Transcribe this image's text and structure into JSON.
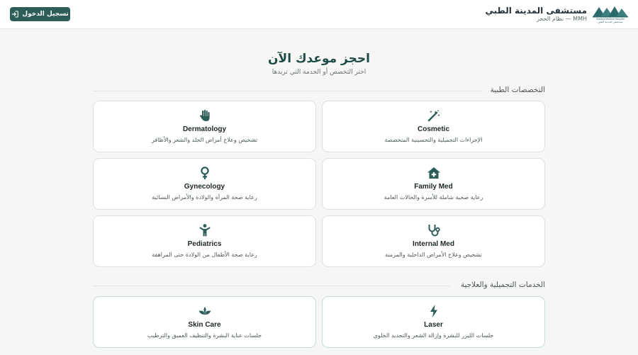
{
  "header": {
    "brand_title": "مستشفى المدينة الطبي",
    "brand_sub": "MMH — نظام الحجز",
    "logo_line1": "Madina Medical Hospital",
    "logo_line2": "مستشفى المدينة الطبي",
    "login_label": "تسجيل الدخول"
  },
  "hero": {
    "title": "احجز موعدك الآن",
    "subtitle": "اختر التخصص أو الخدمة التي تريدها"
  },
  "specialties": {
    "title": "التخصصات الطبية",
    "items": [
      {
        "name": "Cosmetic",
        "desc": "الإجراءات التجميلية والتحسينية المتخصصة",
        "icon": "magic-wand-icon"
      },
      {
        "name": "Dermatology",
        "desc": "تشخيص وعلاج أمراض الجلد والشعر والأظافر",
        "icon": "hand-icon"
      },
      {
        "name": "Family Med",
        "desc": "رعاية صحية شاملة للأسرة والحالات العامة",
        "icon": "house-medical-icon"
      },
      {
        "name": "Gynecology",
        "desc": "رعاية صحة المرأة والولادة والأمراض النسائية",
        "icon": "venus-icon"
      },
      {
        "name": "Internal Med",
        "desc": "تشخيص وعلاج الأمراض الداخلية والمزمنة",
        "icon": "stethoscope-icon"
      },
      {
        "name": "Pediatrics",
        "desc": "رعاية صحة الأطفال من الولادة حتى المراهقة",
        "icon": "child-icon"
      }
    ]
  },
  "services": {
    "title": "الخدمات التجميلية والعلاجية",
    "items": [
      {
        "name": "Laser",
        "desc": "جلسات الليزر للبشرة وإزالة الشعر والتجديد الخلوي",
        "icon": "bolt-icon"
      },
      {
        "name": "Skin Care",
        "desc": "جلسات عناية البشرة والتنظيف العميق والترطيب",
        "icon": "spa-icon"
      }
    ]
  },
  "colors": {
    "primary": "#2d5d59",
    "icon": "#2d5d59",
    "background": "#f6f6f4"
  }
}
